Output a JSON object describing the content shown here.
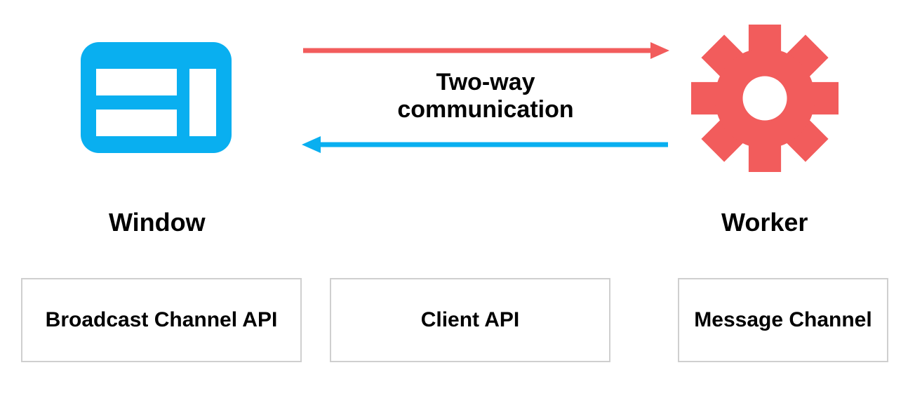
{
  "diagram": {
    "left_label": "Window",
    "right_label": "Worker",
    "caption_line1": "Two-way",
    "caption_line2": "communication",
    "icon_left_name": "window-icon",
    "icon_right_name": "gear-icon",
    "colors": {
      "window_blue": "#09aff0",
      "gear_red": "#f25c5c",
      "arrow_red": "#f25c5c",
      "arrow_blue": "#09aff0"
    },
    "arrows": [
      {
        "direction": "right",
        "color": "#f25c5c",
        "from": "Window",
        "to": "Worker"
      },
      {
        "direction": "left",
        "color": "#09aff0",
        "from": "Worker",
        "to": "Window"
      }
    ]
  },
  "api_boxes": {
    "box1": "Broadcast Channel API",
    "box2": "Client API",
    "box3": "Message Channel"
  }
}
